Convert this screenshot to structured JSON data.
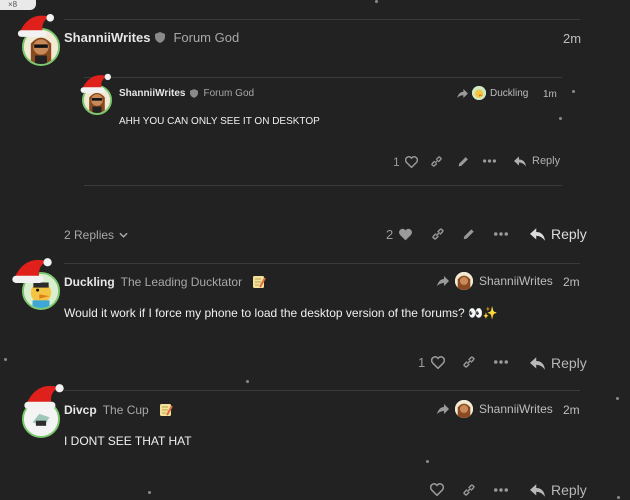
{
  "top_badge": "×8",
  "posts": [
    {
      "username": "ShanniiWrites",
      "title": "Forum God",
      "time": "2m"
    },
    {
      "username": "ShanniiWrites",
      "title": "Forum God",
      "reply_to": "Duckling",
      "time": "1m",
      "body": "AHH YOU CAN ONLY SEE IT ON DESKTOP",
      "like_count": "1",
      "reply_label": "Reply"
    },
    {
      "replies_summary": "2 Replies",
      "like_count": "2",
      "reply_label": "Reply"
    },
    {
      "username": "Duckling",
      "title": "The Leading Ducktator",
      "reply_to": "ShanniiWrites",
      "time": "2m",
      "body": "Would it work if I force my phone to load the desktop version of the forums? 👀✨",
      "like_count": "1",
      "reply_label": "Reply"
    },
    {
      "username": "Divcp",
      "title": "The Cup",
      "reply_to": "ShanniiWrites",
      "time": "2m",
      "body": "I DONT SEE THAT HAT",
      "reply_label": "Reply"
    }
  ],
  "colors": {
    "background": "#222222",
    "divider": "#3a3a3a",
    "avatar_ring": "#7bc96f",
    "hat_red": "#e0211b"
  },
  "icons": [
    "shield-icon",
    "share-arrow-icon",
    "heart-icon",
    "link-icon",
    "pencil-icon",
    "more-icon",
    "reply-icon",
    "chevron-down-icon",
    "santa-hat-icon",
    "note-emoji-icon"
  ]
}
